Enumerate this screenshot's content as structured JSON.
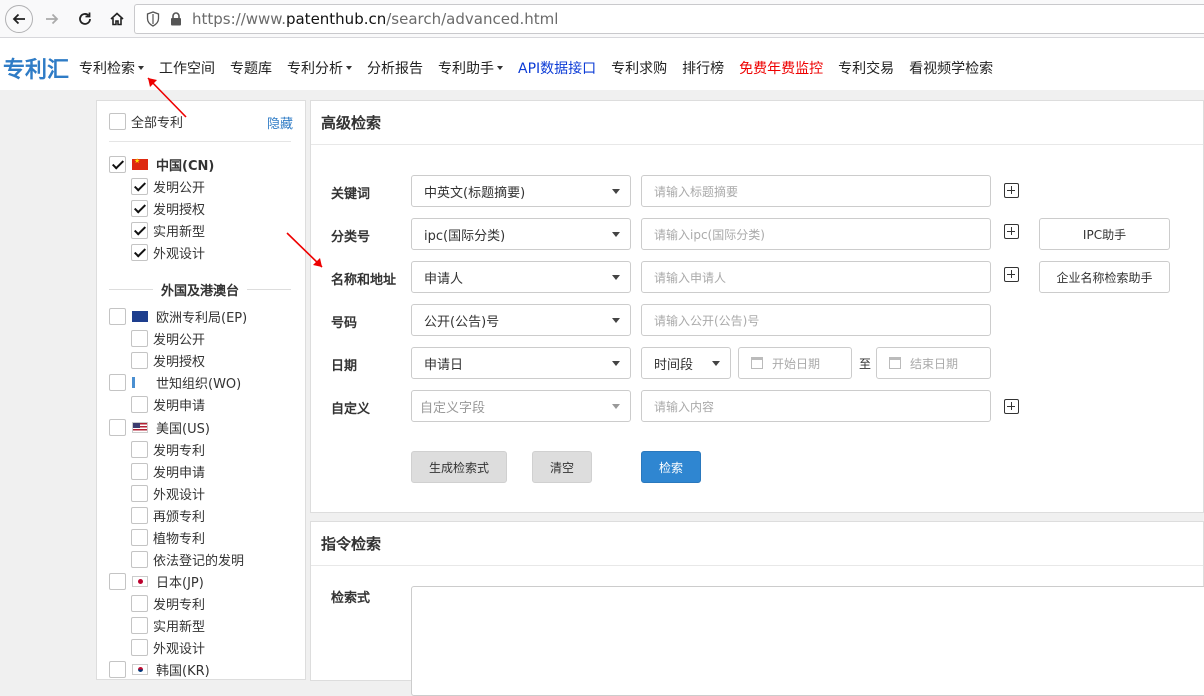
{
  "browser": {
    "url_prefix": "https://www.",
    "url_domain": "patenthub.cn",
    "url_path": "/search/advanced.html"
  },
  "site_nav": {
    "logo": "专利汇",
    "items": [
      {
        "label": "专利检索",
        "has_caret": true,
        "style": "normal"
      },
      {
        "label": "工作空间",
        "has_caret": false,
        "style": "normal"
      },
      {
        "label": "专题库",
        "has_caret": false,
        "style": "normal"
      },
      {
        "label": "专利分析",
        "has_caret": true,
        "style": "normal"
      },
      {
        "label": "分析报告",
        "has_caret": false,
        "style": "normal"
      },
      {
        "label": "专利助手",
        "has_caret": true,
        "style": "normal"
      },
      {
        "label": "API数据接口",
        "has_caret": false,
        "style": "blue"
      },
      {
        "label": "专利求购",
        "has_caret": false,
        "style": "normal"
      },
      {
        "label": "排行榜",
        "has_caret": false,
        "style": "normal"
      },
      {
        "label": "免费年费监控",
        "has_caret": false,
        "style": "red"
      },
      {
        "label": "专利交易",
        "has_caret": false,
        "style": "normal"
      },
      {
        "label": "看视频学检索",
        "has_caret": false,
        "style": "normal"
      }
    ]
  },
  "sidebar": {
    "all_patents": "全部专利",
    "hide": "隐藏",
    "china": {
      "label": "中国(CN)",
      "checked": true,
      "items": [
        {
          "label": "发明公开",
          "checked": true
        },
        {
          "label": "发明授权",
          "checked": true
        },
        {
          "label": "实用新型",
          "checked": true
        },
        {
          "label": "外观设计",
          "checked": true
        }
      ]
    },
    "foreign_heading": "外国及港澳台",
    "ep": {
      "label": "欧洲专利局(EP)",
      "items": [
        "发明公开",
        "发明授权"
      ]
    },
    "wo": {
      "label": "世知组织(WO)",
      "items": [
        "发明申请"
      ]
    },
    "us": {
      "label": "美国(US)",
      "items": [
        "发明专利",
        "发明申请",
        "外观设计",
        "再颁专利",
        "植物专利",
        "依法登记的发明"
      ]
    },
    "jp": {
      "label": "日本(JP)",
      "items": [
        "发明专利",
        "实用新型",
        "外观设计"
      ]
    },
    "kr": {
      "label": "韩国(KR)"
    }
  },
  "advanced": {
    "title": "高级检索",
    "rows": [
      {
        "label": "关键词",
        "select": "中英文(标题摘要)",
        "placeholder": "请输入标题摘要"
      },
      {
        "label": "分类号",
        "select": "ipc(国际分类)",
        "placeholder": "请输入ipc(国际分类)",
        "helper": "IPC助手"
      },
      {
        "label": "名称和地址",
        "select": "申请人",
        "placeholder": "请输入申请人",
        "helper": "企业名称检索助手"
      },
      {
        "label": "号码",
        "select": "公开(公告)号",
        "placeholder": "请输入公开(公告)号"
      },
      {
        "label": "日期",
        "select": "申请日",
        "period": "时间段",
        "start": "开始日期",
        "to": "至",
        "end": "结束日期"
      },
      {
        "label": "自定义",
        "select": "自定义字段",
        "placeholder": "请输入内容"
      }
    ],
    "buttons": {
      "generate": "生成检索式",
      "clear": "清空",
      "search": "检索"
    }
  },
  "command": {
    "title": "指令检索",
    "label": "检索式"
  }
}
